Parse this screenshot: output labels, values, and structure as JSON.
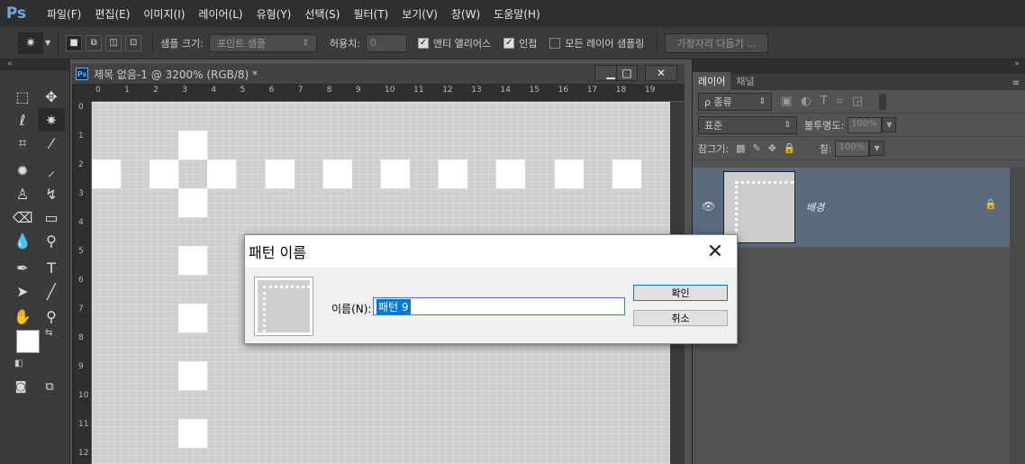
{
  "app": {
    "logo": "Ps"
  },
  "menu": [
    {
      "label": "파일(F)"
    },
    {
      "label": "편집(E)"
    },
    {
      "label": "이미지(I)"
    },
    {
      "label": "레이어(L)"
    },
    {
      "label": "유형(Y)"
    },
    {
      "label": "선택(S)"
    },
    {
      "label": "필터(T)"
    },
    {
      "label": "보기(V)"
    },
    {
      "label": "창(W)"
    },
    {
      "label": "도움말(H)"
    }
  ],
  "options": {
    "sample_size_label": "샘플 크기:",
    "sample_size_value": "포인트 샘플",
    "tolerance_label": "허용치:",
    "tolerance_value": "0",
    "antialias_label": "앤티 앨리어스",
    "contiguous_label": "인접",
    "sample_all_label": "모든 레이어 샘플링",
    "refine_edge_label": "가장자리 다듬기 ..."
  },
  "document": {
    "title": "제목 없음-1 @ 3200% (RGB/8) *",
    "ps_badge": "Ps",
    "ruler_h": [
      "0",
      "1",
      "2",
      "3",
      "4",
      "5",
      "6",
      "7",
      "8",
      "9",
      "10",
      "11",
      "12",
      "13",
      "14",
      "15",
      "16",
      "17",
      "18",
      "19"
    ],
    "ruler_v": [
      "0",
      "1",
      "2",
      "3",
      "4",
      "5",
      "6",
      "7",
      "8",
      "9",
      "10",
      "11",
      "12"
    ],
    "minimize": "▁",
    "maximize": "□",
    "close": "✕"
  },
  "layers_panel": {
    "tab_layers": "레이어",
    "tab_channels": "채널",
    "filter_label": "ρ 종류",
    "blend_mode": "표준",
    "opacity_label": "불투명도:",
    "opacity_value": "100%",
    "lock_label": "잠그기:",
    "fill_label": "칠:",
    "fill_value": "100%",
    "layer_name": "배경"
  },
  "dialog": {
    "title": "패턴 이름",
    "name_label": "이름(N):",
    "name_value": "패턴 9",
    "ok_label": "확인",
    "cancel_label": "취소",
    "close_glyph": "✕"
  },
  "colors": {
    "accent": "#0078d7",
    "canvas": "#cfcfcf",
    "layer_selected": "#5a6a7f"
  }
}
